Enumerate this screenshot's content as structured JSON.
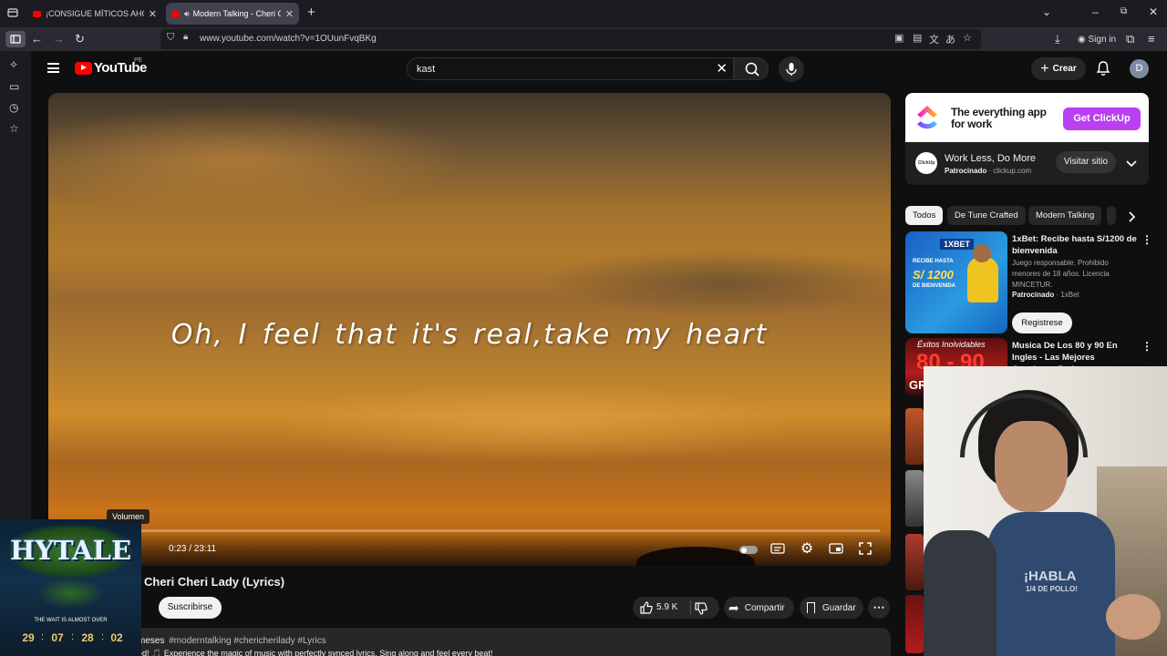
{
  "browser": {
    "tabs": [
      {
        "title": "¡CONSIGUE MÍTICOS AHORA! D",
        "active": false
      },
      {
        "title": "Modern Talking - Cheri Che",
        "active": true
      }
    ],
    "new_tab": "+",
    "url": "www.youtube.com/watch?v=1OUunFvqBKg",
    "sign_in": "Sign in"
  },
  "youtube": {
    "logo": "YouTube",
    "region": "PE",
    "search_value": "kast",
    "create_label": "Crear",
    "avatar_letter": "D"
  },
  "player": {
    "lyrics": "Oh, I feel that it's real,take my heart",
    "time": "0:23 / 23:11",
    "progress": 0.0166,
    "tooltip": "Volumen"
  },
  "video": {
    "title": "Cheri Cheri Lady (Lyrics)",
    "subscribe": "Suscribirse",
    "likes": "5.9 K",
    "share": "Compartir",
    "save": "Guardar",
    "desc_age": "meses",
    "desc_tags": "#moderntalking #chericherilady #Lyrics",
    "desc_text": "ed! 🎵 Experience the magic of music with perfectly synced lyrics. Sing along and feel every beat!"
  },
  "ad": {
    "tagline": "The everything app for work",
    "cta": "Get ClickUp",
    "logo_text": "ClickUp",
    "headline": "Work Less, Do More",
    "sponsored": "Patrocinado",
    "domain": "clickup.com",
    "visit": "Visitar sitio"
  },
  "chips": [
    "Todos",
    "De Tune Crafted",
    "Modern Talking"
  ],
  "recs": [
    {
      "title": "1xBet: Recibe hasta S/1200 de bienvenida",
      "desc": "Juego responsable. Prohibido menores de 18 años. Licencia MINCETUR.",
      "sponsored": "Patrocinado",
      "advertiser": "1xBet",
      "cta": "Registrese",
      "thumb_brand": "1XBET",
      "thumb_lines": [
        "RECIBE HASTA",
        "S/ 1200",
        "DE BIENVENIDA"
      ]
    },
    {
      "title": "Musica De Los 80 y 90 En Ingles - Las Mejores Canciones De L...",
      "thumb_top": "Éxitos Inolvidables",
      "thumb_big": "80 - 90",
      "thumb_gr": "GR"
    }
  ],
  "overlay": {
    "webcam_shirt": "¡HABLA",
    "webcam_shirt2": "1/4 DE POLLO!",
    "hytale_title": "HYTALE",
    "hytale_sub": "THE WAIT IS ALMOST OVER",
    "countdown": [
      "29",
      "07",
      "28",
      "02"
    ]
  },
  "colors": {
    "accent": "#ff0000",
    "clickup_purple": "#b93ff0",
    "bg": "#0f0f0f"
  }
}
